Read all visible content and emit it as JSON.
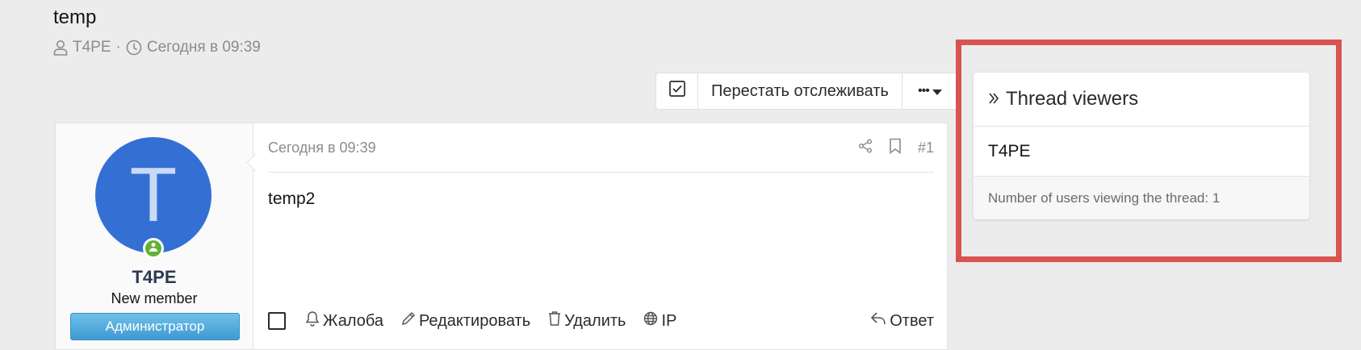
{
  "thread": {
    "title": "temp",
    "author": "T4PE",
    "separator": "·",
    "date": "Сегодня в 09:39"
  },
  "toolbar": {
    "watch_label": "Перестать отслеживать",
    "more_label": "•••"
  },
  "post": {
    "date": "Сегодня в 09:39",
    "number": "#1",
    "body": "temp2",
    "author": {
      "avatar_letter": "T",
      "username": "T4PE",
      "title": "New member",
      "banner": "Администратор"
    },
    "actions": {
      "report": "Жалоба",
      "edit": "Редактировать",
      "delete": "Удалить",
      "ip": "IP",
      "reply": "Ответ"
    }
  },
  "widget": {
    "title": "Thread viewers",
    "viewers": [
      "T4PE"
    ],
    "footer": "Number of users viewing the thread: 1"
  },
  "colors": {
    "highlight": "#d9534f",
    "avatar": "#3470d4",
    "online": "#63b132",
    "banner": "#4aa6dc"
  }
}
